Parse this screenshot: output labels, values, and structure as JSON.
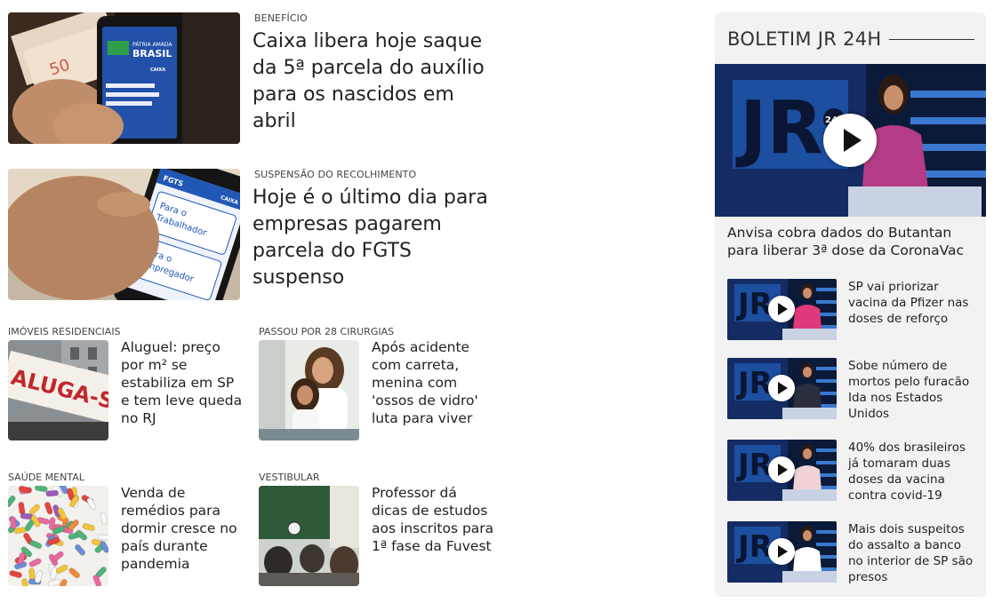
{
  "main_stories": [
    {
      "kicker": "BENEFÍCIO",
      "headline": "Caixa libera hoje saque da 5ª parcela do auxílio para os nascidos em abril",
      "phone_text": "PÁTRIA AMADA BRASIL",
      "phone_label": "CAIXA"
    },
    {
      "kicker": "SUSPENSÃO DO RECOLHIMENTO",
      "headline": "Hoje é o último dia para empresas pagarem parcela do FGTS suspenso",
      "phone_brand": "FGTS",
      "phone_label": "CAIXA",
      "option1": "Para o Trabalhador",
      "option2": "Para o Empregador"
    }
  ],
  "small_stories": [
    {
      "kicker": "IMÓVEIS RESIDENCIAIS",
      "headline": "Aluguel: preço por m² se estabiliza em SP e tem leve queda no RJ",
      "sign_text": "ALUGA-SE"
    },
    {
      "kicker": "PASSOU POR 28 CIRURGIAS",
      "headline": "Após acidente com carreta, menina com 'ossos de vidro' luta para viver"
    },
    {
      "kicker": "SAÚDE MENTAL",
      "headline": "Venda de remédios para dormir cresce no país durante pandemia"
    },
    {
      "kicker": "VESTIBULAR",
      "headline": "Professor dá dicas de estudos aos inscritos para 1ª fase da Fuvest"
    }
  ],
  "sidebar": {
    "title": "BOLETIM JR 24H",
    "main_caption": "Anvisa cobra dados do Butantan para liberar 3ª dose da CoronaVac",
    "logo_text": "JR",
    "logo_badge": "24h",
    "videos": [
      {
        "title": "SP vai priorizar vacina da Pfizer nas doses de reforço",
        "dress": "#e0397a"
      },
      {
        "title": "Sobe número de mortos pelo furacão Ida nos Estados Unidos",
        "dress": "#2b2f3d"
      },
      {
        "title": "40% dos brasileiros já tomaram duas doses da vacina contra covid-19",
        "dress": "#f1d2d6"
      },
      {
        "title": "Mais dois suspeitos do assalto a banco no interior de SP são presos",
        "dress": "#ffffff"
      }
    ]
  },
  "colors": {
    "studio_blue": "#1d4fa0",
    "studio_dark": "#0c1a3a",
    "presenter_dress": "#b43c86",
    "sidebar_bg": "#f2f2f2"
  }
}
